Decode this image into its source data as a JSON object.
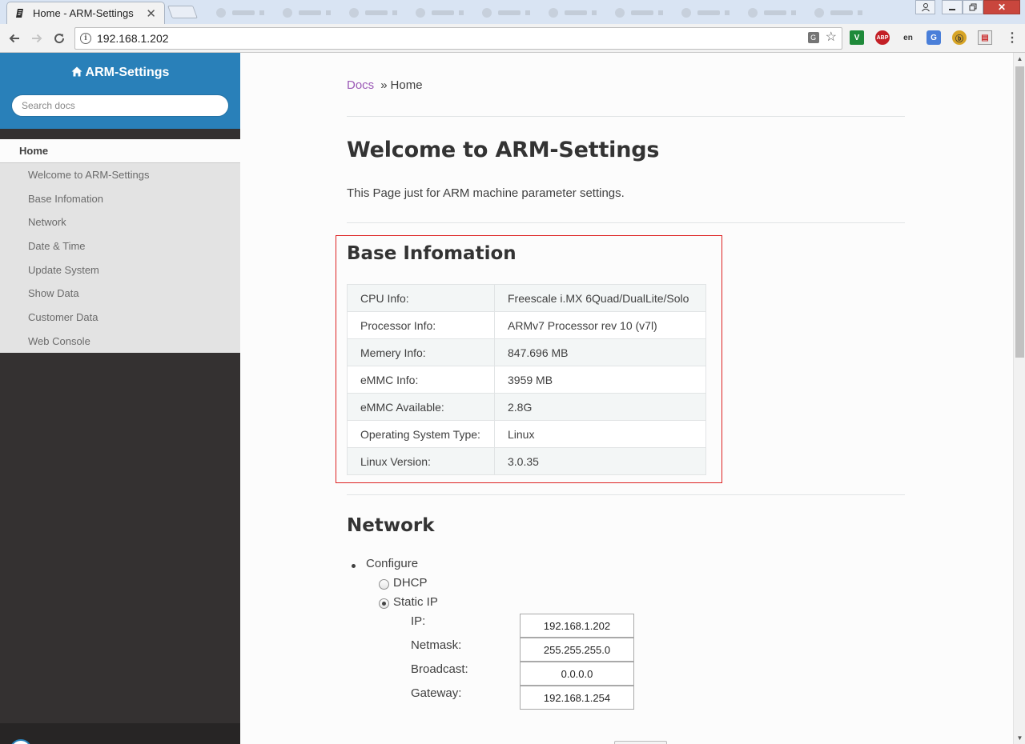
{
  "browser": {
    "tab_title": "Home - ARM-Settings",
    "tab_close": "✕",
    "url": "192.168.1.202",
    "window_close": "✕"
  },
  "sidebar": {
    "brand": "ARM-Settings",
    "search_placeholder": "Search docs",
    "current_page": "Home",
    "items": [
      {
        "label": "Welcome to ARM-Settings"
      },
      {
        "label": "Base Infomation"
      },
      {
        "label": "Network"
      },
      {
        "label": "Date & Time"
      },
      {
        "label": "Update System"
      },
      {
        "label": "Show Data"
      },
      {
        "label": "Customer Data"
      },
      {
        "label": "Web Console"
      }
    ]
  },
  "breadcrumb": {
    "root": "Docs",
    "separator": "»",
    "current": "Home"
  },
  "main": {
    "title": "Welcome to ARM-Settings",
    "intro": "This Page just for ARM machine parameter settings.",
    "base_info": {
      "heading": "Base Infomation",
      "rows": [
        {
          "key": "CPU Info:",
          "value": "Freescale i.MX 6Quad/DualLite/Solo"
        },
        {
          "key": "Processor Info:",
          "value": "ARMv7 Processor rev 10 (v7l)"
        },
        {
          "key": "Memery Info:",
          "value": "847.696 MB"
        },
        {
          "key": "eMMC Info:",
          "value": "3959 MB"
        },
        {
          "key": "eMMC Available:",
          "value": "2.8G"
        },
        {
          "key": "Operating System Type:",
          "value": "Linux"
        },
        {
          "key": "Linux Version:",
          "value": "3.0.35"
        }
      ]
    },
    "network": {
      "heading": "Network",
      "configure_label": "Configure",
      "mode_dhcp": "DHCP",
      "mode_static": "Static IP",
      "selected_mode": "Static IP",
      "fields": [
        {
          "label": "IP:",
          "value": "192.168.1.202"
        },
        {
          "label": "Netmask:",
          "value": "255.255.255.0"
        },
        {
          "label": "Broadcast:",
          "value": "0.0.0.0"
        },
        {
          "label": "Gateway:",
          "value": "192.168.1.254"
        }
      ]
    }
  },
  "colors": {
    "sidebar_header": "#2980b9",
    "sidebar_bg": "#343131",
    "link": "#9b59b6",
    "highlight_box": "#dd2222"
  },
  "icons": {
    "tab": "document-icon",
    "brand": "home-icon",
    "omnibox": "info-icon"
  }
}
